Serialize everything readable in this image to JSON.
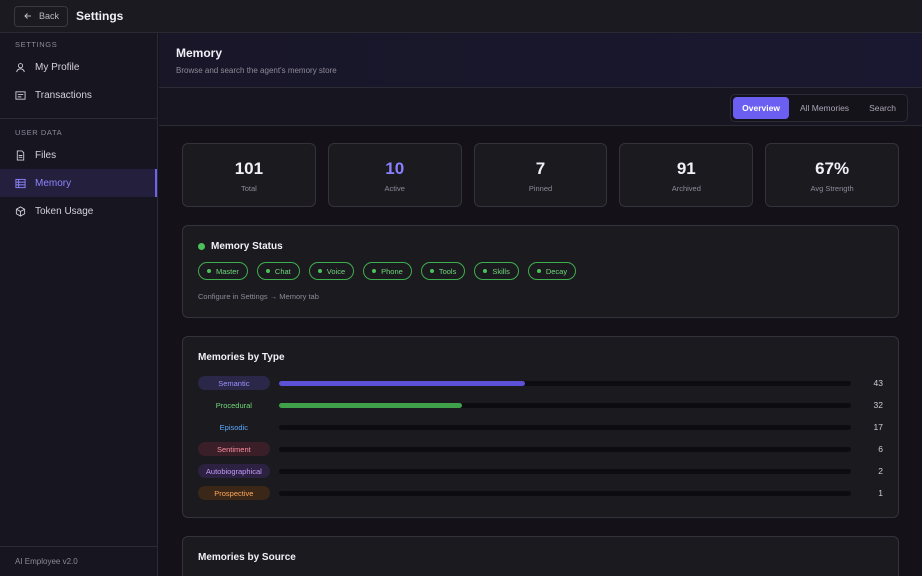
{
  "topbar": {
    "back_label": "Back",
    "title": "Settings"
  },
  "sidebar": {
    "section1": "SETTINGS",
    "items1": [
      {
        "label": "My Profile",
        "icon": "user-icon"
      },
      {
        "label": "Transactions",
        "icon": "receipt-icon"
      }
    ],
    "section2": "USER DATA",
    "items2": [
      {
        "label": "Files",
        "icon": "file-icon"
      },
      {
        "label": "Memory",
        "icon": "memory-icon",
        "active": true
      },
      {
        "label": "Token Usage",
        "icon": "cube-icon"
      }
    ],
    "version": "AI Employee v2.0"
  },
  "header": {
    "title": "Memory",
    "subtitle": "Browse and search the agent's memory store"
  },
  "tabs": [
    {
      "label": "Overview",
      "active": true
    },
    {
      "label": "All Memories"
    },
    {
      "label": "Search"
    }
  ],
  "stats": [
    {
      "value": "101",
      "label": "Total"
    },
    {
      "value": "10",
      "label": "Active",
      "accent": true
    },
    {
      "value": "7",
      "label": "Pinned"
    },
    {
      "value": "91",
      "label": "Archived"
    },
    {
      "value": "67%",
      "label": "Avg Strength"
    }
  ],
  "status": {
    "title": "Memory Status",
    "chips": [
      "Master",
      "Chat",
      "Voice",
      "Phone",
      "Tools",
      "Skills",
      "Decay"
    ],
    "hint": "Configure in Settings → Memory tab",
    "status_color": "#4cc25a"
  },
  "by_type": {
    "title": "Memories by Type",
    "max": 43,
    "rows": [
      {
        "label": "Semantic",
        "count": 43,
        "fill": 0.43,
        "text_color": "#9b93ff",
        "bg": "#2a2748",
        "bar": "#5b50d6"
      },
      {
        "label": "Procedural",
        "count": 32,
        "fill": 0.32,
        "text_color": "#6fd97a",
        "bg": "transparent",
        "bar": "#3fa24a"
      },
      {
        "label": "Episodic",
        "count": 17,
        "fill": 0,
        "text_color": "#5aa8ff",
        "bg": "transparent",
        "bar": "#2d6cc0"
      },
      {
        "label": "Sentiment",
        "count": 6,
        "fill": 0,
        "text_color": "#ff8fa3",
        "bg": "#3a1e28",
        "bar": "#c04a63"
      },
      {
        "label": "Autobiographical",
        "count": 2,
        "fill": 0,
        "text_color": "#c59bff",
        "bg": "#2c2140",
        "bar": "#7a4fc0"
      },
      {
        "label": "Prospective",
        "count": 1,
        "fill": 0,
        "text_color": "#ffa95a",
        "bg": "#3a2718",
        "bar": "#c06a2d"
      }
    ]
  },
  "by_source": {
    "title": "Memories by Source"
  }
}
